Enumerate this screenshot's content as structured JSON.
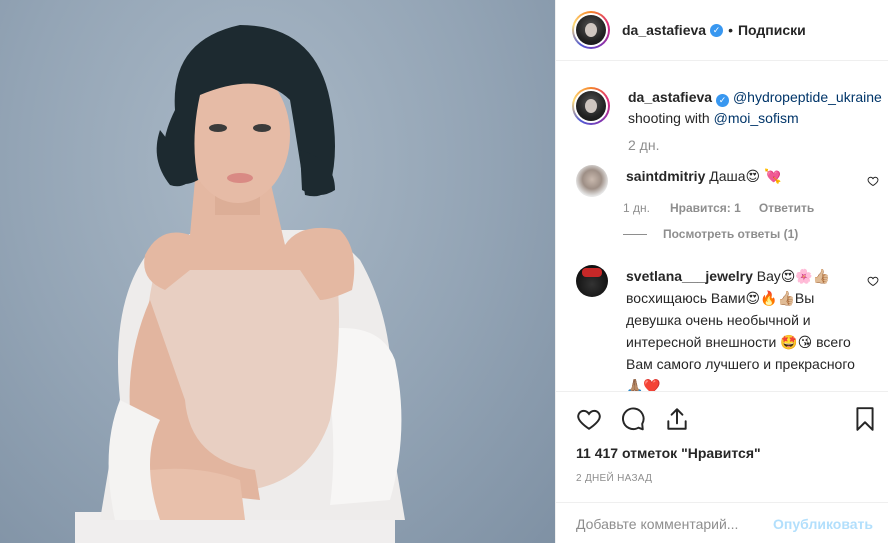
{
  "header": {
    "username": "da_astafieva",
    "separator": "•",
    "follow_label": "Подписки"
  },
  "caption": {
    "username": "da_astafieva",
    "mention1": "@hydropeptide_ukraine",
    "text": "shooting with",
    "mention2": "@moi_sofism",
    "time": "2 дн."
  },
  "comments": [
    {
      "username": "saintdmitriy",
      "text": "Даша😍 💘",
      "time": "1 дн.",
      "likes": "Нравится: 1",
      "reply_label": "Ответить",
      "view_replies": "Посмотреть ответы (1)"
    },
    {
      "username": "svetlana___jewelry",
      "text": "Вау😍🌸👍🏼 восхищаюсь Вами😍🔥👍🏼Вы девушка очень необычной и интересной внешности 🤩😘 всего Вам самого лучшего и прекрасного 🙏🏽❤️"
    }
  ],
  "actions": {
    "likes_text": "11 417 отметок \"Нравится\"",
    "posted_ago": "2 дней назад",
    "comment_placeholder": "Добавьте комментарий...",
    "publish_label": "Опубликовать"
  },
  "colors": {
    "link": "#003569",
    "verified": "#3897f0",
    "publish_disabled": "#b2dffc",
    "secondary_text": "#8e8e8e"
  }
}
